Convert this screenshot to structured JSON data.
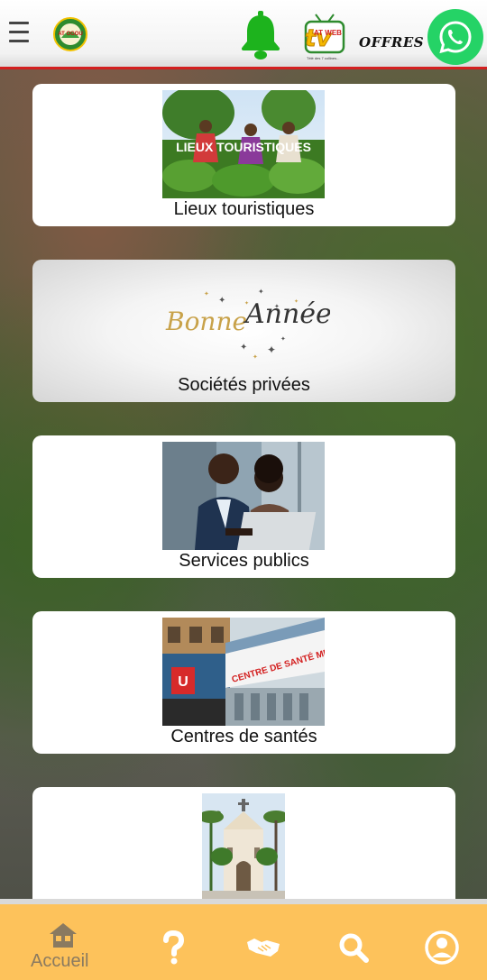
{
  "header": {
    "menu_icon": "hamburger-menu-icon",
    "logo_text": "AT OGOU",
    "bell_icon": "notification-bell-icon",
    "tv_logo": {
      "brand": "tv",
      "badge": "AT WEB",
      "tagline": "Télé des 7 collines..."
    },
    "offres_label": "OFFRES",
    "whatsapp_icon": "whatsapp-icon"
  },
  "cards": [
    {
      "label": "Lieux touristiques",
      "image_overlay": "LIEUX TOURISTIQUES"
    },
    {
      "label": "Sociétés privées",
      "image_text_1": "Bonne",
      "image_text_2": "Année"
    },
    {
      "label": "Services publics"
    },
    {
      "label": "Centres de santés",
      "image_sign": "CENTRE DE SANTÉ MÉDICAL"
    },
    {
      "label": ""
    }
  ],
  "bottom_nav": {
    "items": [
      {
        "label": "Accueil",
        "icon": "home-icon"
      },
      {
        "label": "",
        "icon": "question-mark-icon"
      },
      {
        "label": "",
        "icon": "handshake-icon"
      },
      {
        "label": "",
        "icon": "search-icon"
      },
      {
        "label": "",
        "icon": "user-profile-icon"
      }
    ]
  },
  "colors": {
    "header_border": "#d32020",
    "bell": "#1db31d",
    "whatsapp": "#25d366",
    "bottom_nav_bg": "#fdc25b",
    "nav_icon": "#ffffff",
    "nav_label": "#8a7a60"
  }
}
